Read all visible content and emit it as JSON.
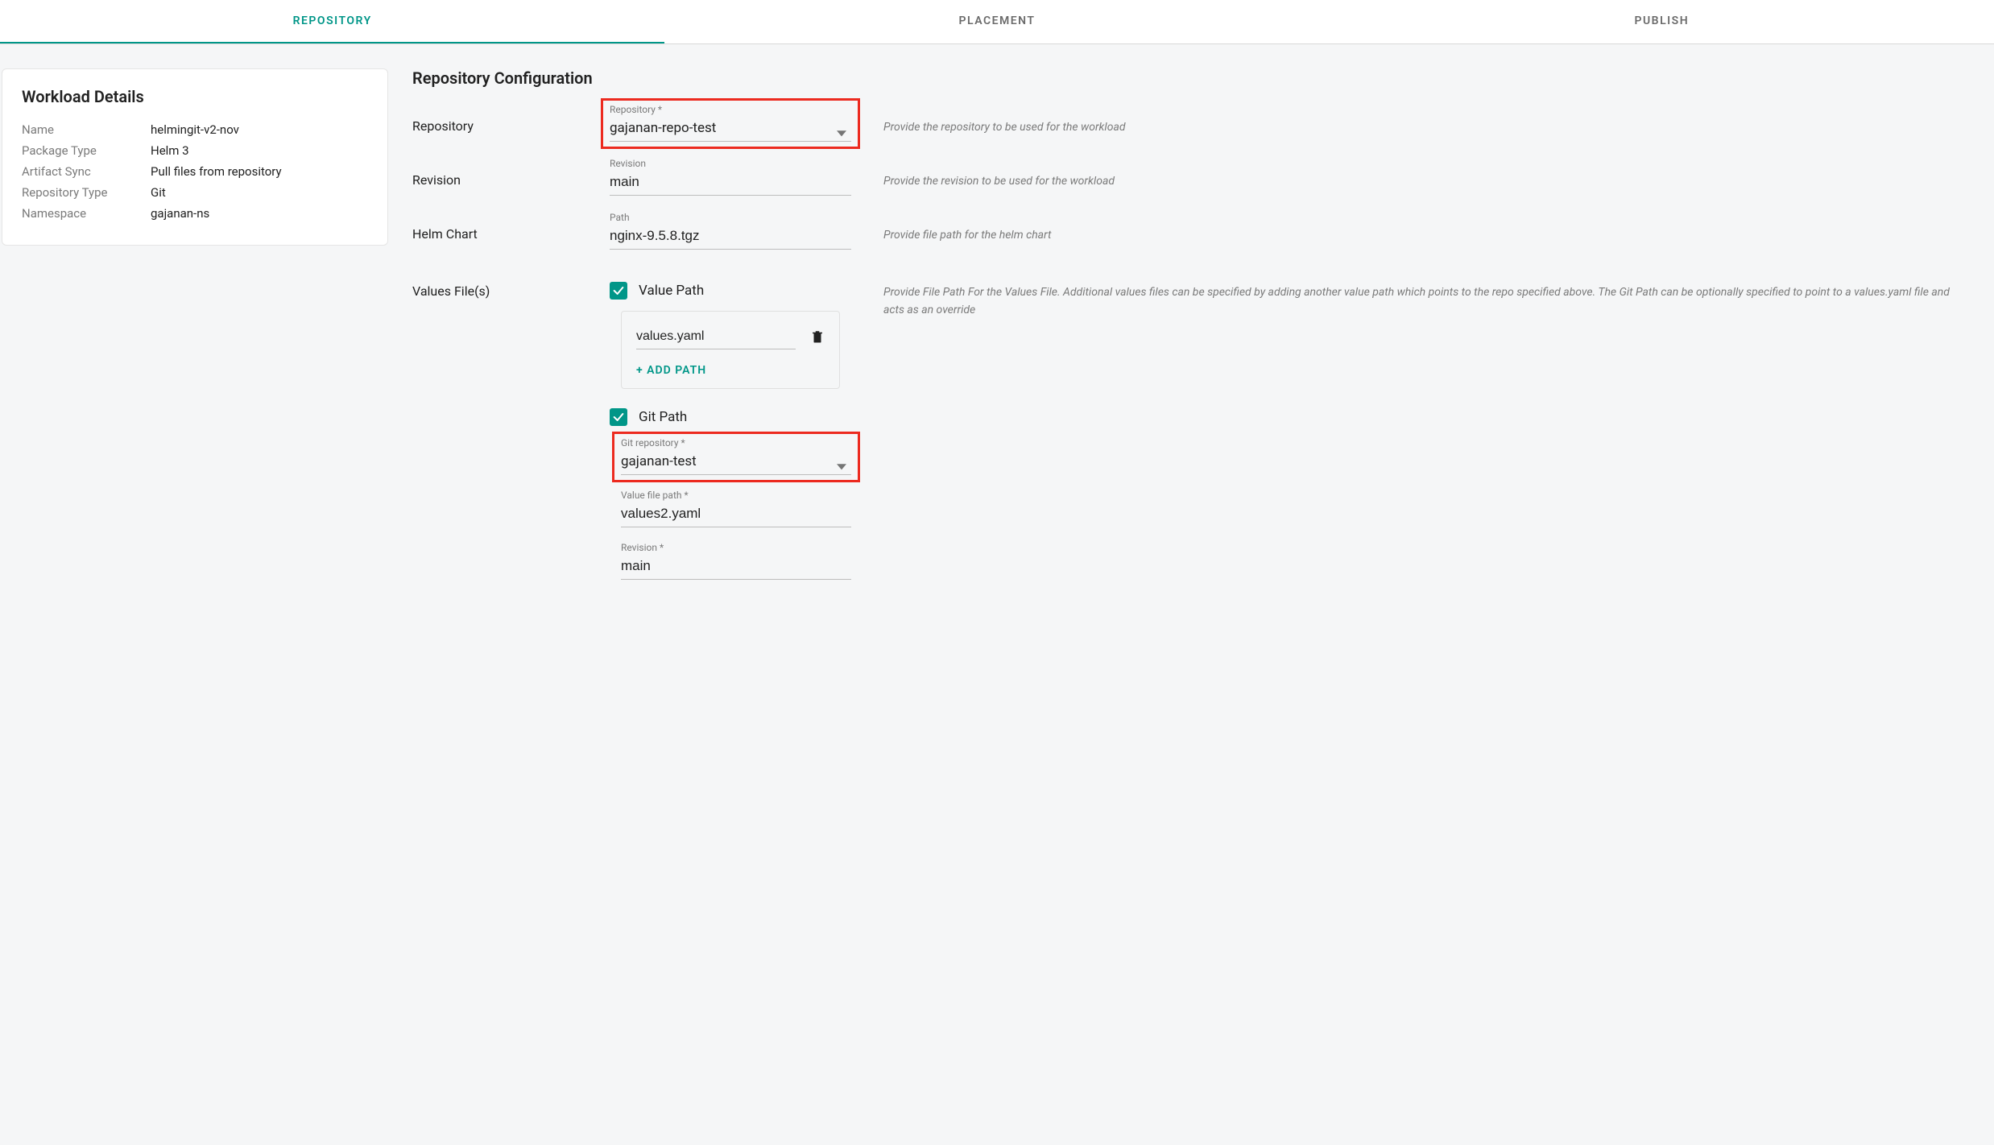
{
  "tabs": {
    "repository": "REPOSITORY",
    "placement": "PLACEMENT",
    "publish": "PUBLISH"
  },
  "workload": {
    "title": "Workload Details",
    "labels": {
      "name": "Name",
      "package_type": "Package Type",
      "artifact_sync": "Artifact Sync",
      "repository_type": "Repository Type",
      "namespace": "Namespace"
    },
    "values": {
      "name": "helmingit-v2-nov",
      "package_type": "Helm 3",
      "artifact_sync": "Pull files from repository",
      "repository_type": "Git",
      "namespace": "gajanan-ns"
    }
  },
  "config": {
    "title": "Repository Configuration",
    "repository": {
      "row_label": "Repository",
      "float_label": "Repository *",
      "value": "gajanan-repo-test",
      "help": "Provide the repository to be used for the workload"
    },
    "revision": {
      "row_label": "Revision",
      "float_label": "Revision",
      "value": "main",
      "help": "Provide the revision to be used for the workload"
    },
    "helm_chart": {
      "row_label": "Helm Chart",
      "float_label": "Path",
      "value": "nginx-9.5.8.tgz",
      "help": "Provide file path for the helm chart"
    },
    "values_files": {
      "row_label": "Values File(s)",
      "value_path_cb_label": "Value Path",
      "paths": [
        "values.yaml"
      ],
      "add_path_label": "+ ADD  PATH",
      "help": "Provide File Path For the Values File. Additional values files can be specified by adding another value path which points to the repo specified above. The Git Path can be optionally specified to point to a values.yaml file and acts as an override",
      "git_path_cb_label": "Git Path",
      "git_repo_float_label": "Git repository *",
      "git_repo_value": "gajanan-test",
      "value_file_path_float_label": "Value file path *",
      "value_file_path_value": "values2.yaml",
      "git_revision_float_label": "Revision *",
      "git_revision_value": "main"
    }
  }
}
